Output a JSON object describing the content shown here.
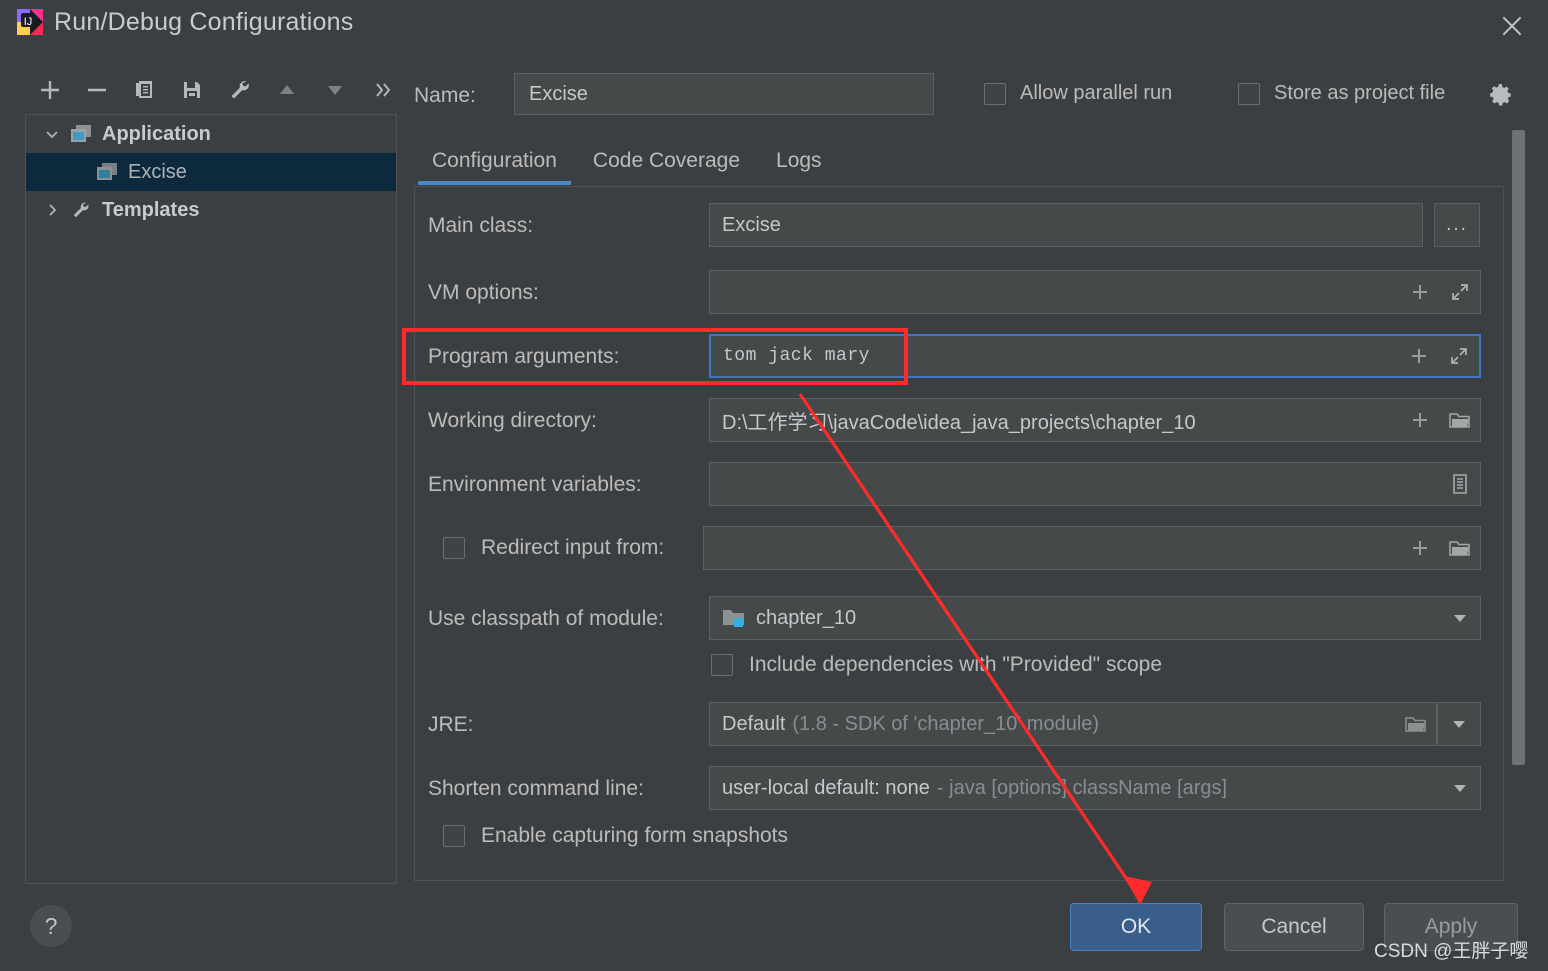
{
  "window": {
    "title": "Run/Debug Configurations",
    "app_icon": "intellij-idea-icon",
    "close_icon": "close-icon"
  },
  "toolbar": {
    "buttons": [
      {
        "name": "add-configuration-button",
        "icon": "plus-icon"
      },
      {
        "name": "remove-configuration-button",
        "icon": "minus-icon"
      },
      {
        "name": "copy-configuration-button",
        "icon": "copy-icon"
      },
      {
        "name": "save-configuration-button",
        "icon": "save-icon"
      },
      {
        "name": "edit-templates-button",
        "icon": "wrench-icon"
      },
      {
        "name": "move-up-button",
        "icon": "triangle-up-icon"
      },
      {
        "name": "move-down-button",
        "icon": "triangle-down-icon"
      },
      {
        "name": "more-options-button",
        "icon": "chevron-double-right-icon"
      }
    ]
  },
  "tree": {
    "items": [
      {
        "label": "Application",
        "icon": "application-icon",
        "twisty": "chevron-down-icon",
        "level": 0,
        "selected": false
      },
      {
        "label": "Excise",
        "icon": "application-icon",
        "twisty": "none",
        "level": 1,
        "selected": true
      },
      {
        "label": "Templates",
        "icon": "wrench-icon",
        "twisty": "chevron-right-icon",
        "level": 0,
        "selected": false
      }
    ]
  },
  "header": {
    "name_label": "Name:",
    "name_value": "Excise",
    "name_placeholder": "",
    "allow_parallel_run": {
      "label": "Allow parallel run",
      "checked": false
    },
    "store_as_project_file": {
      "label": "Store as project file",
      "checked": false
    },
    "gear_icon": "gear-icon"
  },
  "tabs": [
    {
      "label": "Configuration",
      "active": true
    },
    {
      "label": "Code Coverage",
      "active": false
    },
    {
      "label": "Logs",
      "active": false
    }
  ],
  "form": {
    "main_class": {
      "label": "Main class:",
      "value": "Excise",
      "browse_label": "..."
    },
    "vm_options": {
      "label": "VM options:",
      "value": "",
      "placeholder": "",
      "add_icon": "plus-icon",
      "expand_icon": "expand-icon"
    },
    "program_arguments": {
      "label": "Program arguments:",
      "value": "tom jack mary",
      "add_icon": "plus-icon",
      "expand_icon": "expand-icon"
    },
    "working_directory": {
      "label": "Working directory:",
      "value": "D:\\工作学习\\javaCode\\idea_java_projects\\chapter_10",
      "add_icon": "plus-icon",
      "browse_icon": "folder-icon"
    },
    "environment_variables": {
      "label": "Environment variables:",
      "value": "",
      "browse_icon": "list-icon"
    },
    "redirect_input": {
      "label": "Redirect input from:",
      "checked": false,
      "value": "",
      "add_icon": "plus-icon",
      "browse_icon": "folder-icon"
    },
    "classpath_module": {
      "label": "Use classpath of module:",
      "value": "chapter_10",
      "icon": "module-folder-icon",
      "dropdown_icon": "chevron-down-icon"
    },
    "include_dependencies": {
      "label": "Include dependencies with \"Provided\" scope",
      "checked": false
    },
    "jre": {
      "label": "JRE:",
      "value": "Default",
      "hint": "(1.8 - SDK of 'chapter_10' module)",
      "browse_icon": "folder-icon",
      "dropdown_icon": "chevron-down-icon"
    },
    "shorten_command_line": {
      "label": "Shorten command line:",
      "value": "user-local default: none",
      "hint": "- java [options] className [args]",
      "dropdown_icon": "chevron-down-icon"
    },
    "enable_form_snapshots": {
      "label": "Enable capturing form snapshots",
      "checked": false
    }
  },
  "footer": {
    "help_label": "?",
    "ok_label": "OK",
    "cancel_label": "Cancel",
    "apply_label": "Apply"
  },
  "annotation": {
    "highlight_target": "program-arguments-row",
    "arrow_target": "ok-button",
    "color": "#ff2b2b"
  },
  "watermark": {
    "text": "CSDN @王胖子嘤"
  }
}
